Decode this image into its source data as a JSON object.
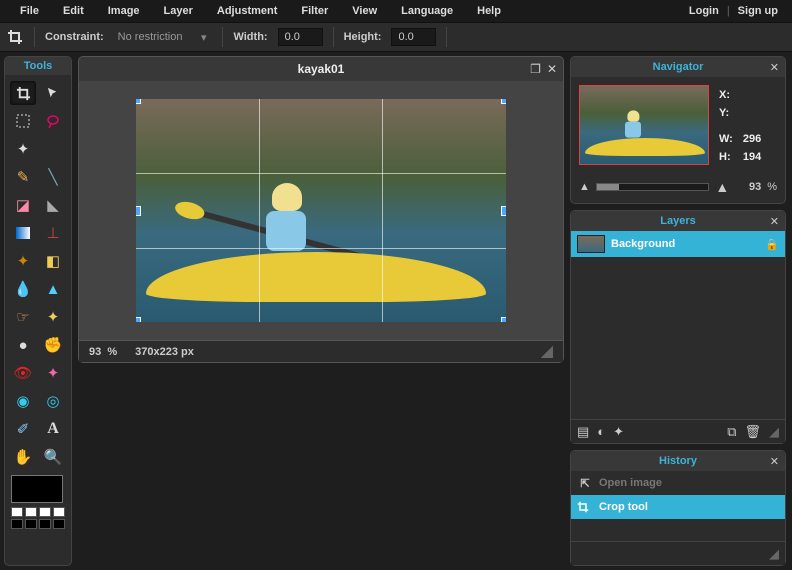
{
  "menu": {
    "items": [
      "File",
      "Edit",
      "Image",
      "Layer",
      "Adjustment",
      "Filter",
      "View",
      "Language",
      "Help"
    ],
    "login": "Login",
    "signup": "Sign up"
  },
  "optbar": {
    "constraint_label": "Constraint:",
    "constraint_value": "No restriction",
    "width_label": "Width:",
    "width_value": "0.0",
    "height_label": "Height:",
    "height_value": "0.0"
  },
  "tools": {
    "title": "Tools"
  },
  "document": {
    "title": "kayak01",
    "zoom": "93",
    "zoom_unit": "%",
    "dims": "370x223 px"
  },
  "navigator": {
    "title": "Navigator",
    "x_label": "X:",
    "y_label": "Y:",
    "w_label": "W:",
    "h_label": "H:",
    "w": "296",
    "h": "194",
    "zoom": "93",
    "zoom_unit": "%"
  },
  "layers": {
    "title": "Layers",
    "items": [
      {
        "name": "Background"
      }
    ]
  },
  "history": {
    "title": "History",
    "items": [
      {
        "name": "Open image",
        "selected": false
      },
      {
        "name": "Crop tool",
        "selected": true
      }
    ]
  },
  "swatch_colors": [
    "#fff",
    "#fff",
    "#fff",
    "#fff",
    "#000",
    "#000",
    "#000",
    "#000"
  ]
}
